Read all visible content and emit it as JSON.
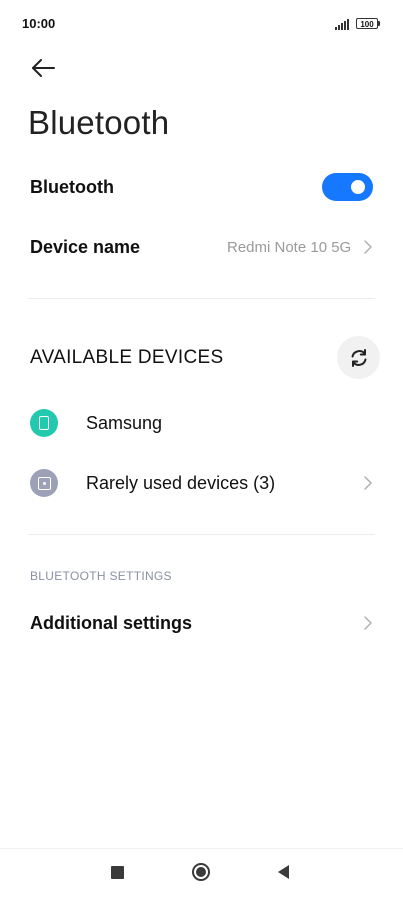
{
  "status_bar": {
    "time": "10:00",
    "battery": "100"
  },
  "header": {
    "title": "Bluetooth"
  },
  "bluetooth_row": {
    "label": "Bluetooth",
    "enabled": true,
    "accent_color": "#1677ff"
  },
  "device_name_row": {
    "label": "Device name",
    "value": "Redmi Note 10 5G"
  },
  "available_devices": {
    "title": "AVAILABLE DEVICES",
    "items": [
      {
        "label": "Samsung",
        "icon": "phone-icon",
        "icon_color": "#22c9ae"
      },
      {
        "label": "Rarely used devices (3)",
        "icon": "device-icon",
        "icon_color": "#9ca1b8"
      }
    ]
  },
  "bluetooth_settings": {
    "header": "BLUETOOTH SETTINGS",
    "items": [
      {
        "label": "Additional settings"
      }
    ]
  }
}
